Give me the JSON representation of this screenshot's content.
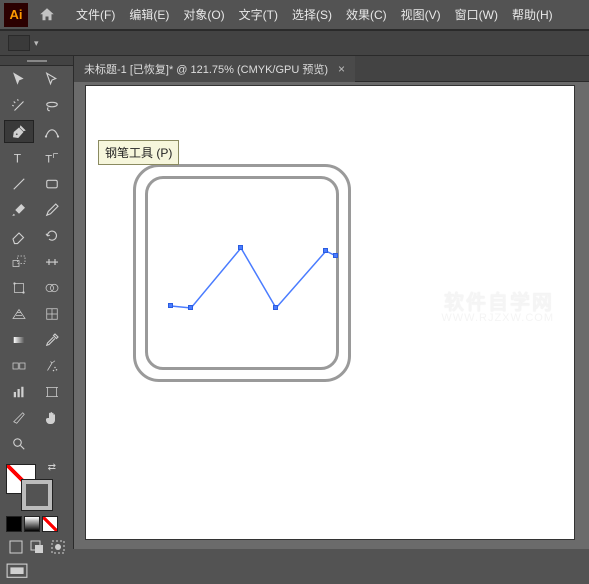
{
  "app": {
    "logo_text": "Ai"
  },
  "menu": {
    "file": "文件(F)",
    "edit": "编辑(E)",
    "object": "对象(O)",
    "type": "文字(T)",
    "select": "选择(S)",
    "effect": "效果(C)",
    "view": "视图(V)",
    "window": "窗口(W)",
    "help": "帮助(H)"
  },
  "doc_tab": {
    "label": "未标题-1 [已恢复]* @ 121.75% (CMYK/GPU 预览)",
    "close": "×"
  },
  "tooltip": {
    "text": "钢笔工具 (P)"
  },
  "watermark": {
    "main": "软件自学网",
    "sub": "WWW.RJZXW.COM"
  },
  "tools": {
    "selection": "selection",
    "direct": "direct-selection",
    "wand": "magic-wand",
    "lasso": "lasso",
    "pen": "pen",
    "curvature": "curvature",
    "type": "type",
    "touch_type": "touch-type",
    "line": "line",
    "rect": "rectangle",
    "brush": "paintbrush",
    "pencil": "pencil",
    "eraser": "eraser",
    "rotate": "rotate",
    "scale": "scale",
    "width": "width",
    "free_transform": "free-transform",
    "shape_builder": "shape-builder",
    "perspective": "perspective",
    "mesh": "mesh",
    "gradient": "gradient",
    "eyedropper": "eyedropper",
    "blend": "blend",
    "symbol": "symbol-sprayer",
    "graph": "column-graph",
    "artboard": "artboard",
    "slice": "slice",
    "hand": "hand",
    "zoom": "zoom"
  }
}
